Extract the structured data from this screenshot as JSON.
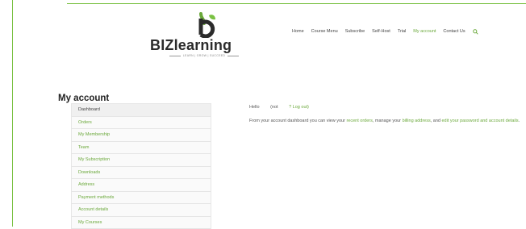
{
  "brand": {
    "name": "BIZlearning",
    "tagline": "LEARN | GROW | SUCCEED",
    "accent_color": "#6aa83a",
    "logo_mark_color": "#7ac143"
  },
  "nav": {
    "items": [
      {
        "label": "Home",
        "active": false
      },
      {
        "label": "Course Menu",
        "active": false
      },
      {
        "label": "Subscribe",
        "active": false
      },
      {
        "label": "Self-Host",
        "active": false
      },
      {
        "label": "Trial",
        "active": false
      },
      {
        "label": "My account",
        "active": true
      },
      {
        "label": "Contact Us",
        "active": false
      }
    ],
    "search_icon": "search-icon"
  },
  "page": {
    "title": "My account"
  },
  "account_nav": {
    "items": [
      {
        "label": "Dashboard",
        "active": true
      },
      {
        "label": "Orders",
        "active": false
      },
      {
        "label": "My Membership",
        "active": false
      },
      {
        "label": "Team",
        "active": false
      },
      {
        "label": "My Subscription",
        "active": false
      },
      {
        "label": "Downloads",
        "active": false
      },
      {
        "label": "Address",
        "active": false
      },
      {
        "label": "Payment methods",
        "active": false
      },
      {
        "label": "Account details",
        "active": false
      },
      {
        "label": "My Courses",
        "active": false
      }
    ]
  },
  "dashboard": {
    "hello_prefix": "Hello",
    "not_text": "(not",
    "logout_link": "? Log out)",
    "intro_text": "From your account dashboard you can view your",
    "recent_orders_link": "recent orders",
    "manage_text": ", manage your",
    "billing_link": "billing address",
    "and_text": ", and",
    "edit_link": "edit your password and account details",
    "end_text": "."
  }
}
